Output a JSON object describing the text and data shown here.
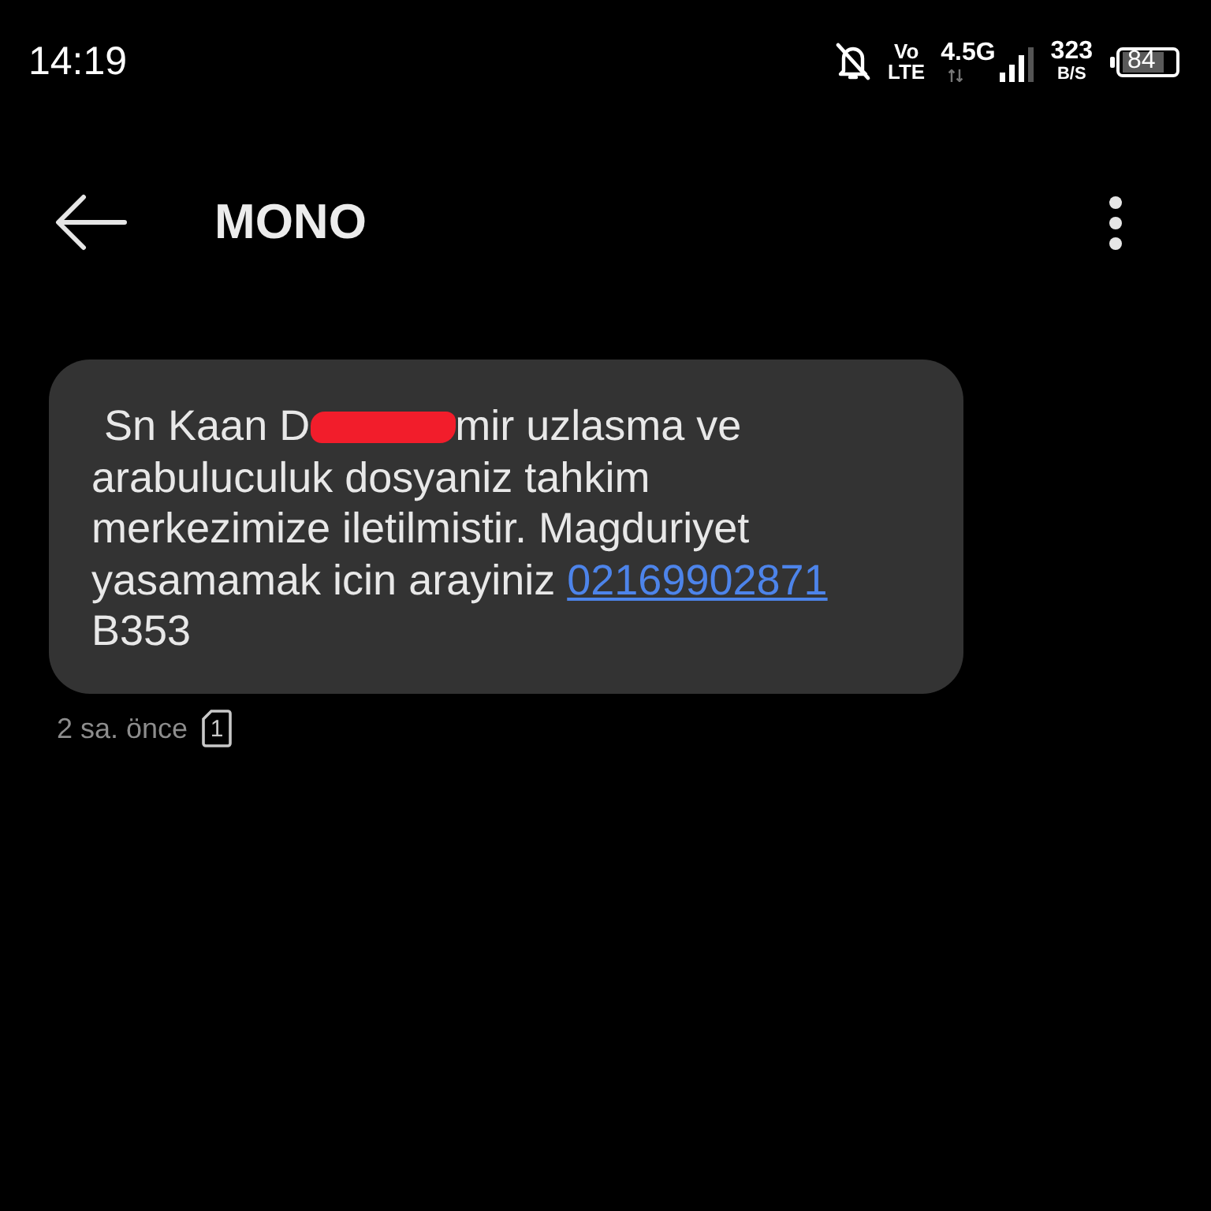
{
  "status_bar": {
    "time": "14:19",
    "volte_top": "Vo",
    "volte_bottom": "LTE",
    "network": "4.5G",
    "speed": "323",
    "speed_unit": "B/S",
    "battery": "84"
  },
  "header": {
    "title": "MONO"
  },
  "messages": [
    {
      "parts": [
        {
          "kind": "text",
          "text": "Sn Kaan D"
        },
        {
          "kind": "redaction"
        },
        {
          "kind": "text",
          "text": "mir uzlasma ve arabuluculuk dosyaniz tahkim merkezimize iletilmistir. Magduriyet yasamamak icin arayiniz"
        },
        {
          "kind": "link",
          "text": "02169902871"
        },
        {
          "kind": "text",
          "text": "B353"
        }
      ],
      "time": "2 sa. önce",
      "sim": "1"
    }
  ]
}
